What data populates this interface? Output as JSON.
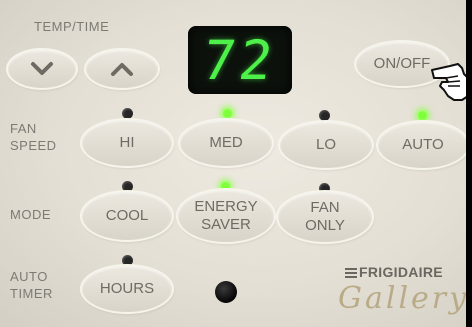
{
  "labels": {
    "temp_time": "TEMP/TIME",
    "fan_speed": "FAN\nSPEED",
    "mode": "MODE",
    "auto_timer": "AUTO\nTIMER"
  },
  "display": {
    "value": "72",
    "color": "#4ef04a"
  },
  "buttons": {
    "power": "ON/OFF",
    "hi": "HI",
    "med": "MED",
    "lo": "LO",
    "auto": "AUTO",
    "cool": "COOL",
    "energy_saver": "ENERGY\nSAVER",
    "fan_only": "FAN\nONLY",
    "hours": "HOURS"
  },
  "indicators": {
    "hi": false,
    "med": true,
    "lo": false,
    "auto": true,
    "cool": false,
    "energy_saver": true,
    "fan_only": false,
    "hours": false
  },
  "brand": {
    "name": "FRIGIDAIRE",
    "line": "Gallery"
  },
  "icons": {
    "temp_down": "chevron-down-icon",
    "temp_up": "chevron-up-icon",
    "pointer": "pointing-hand-icon"
  },
  "colors": {
    "panel": "#e3dfd4",
    "led_on": "#7dff3b",
    "led_off": "#262626",
    "text": "#7d7a74"
  }
}
